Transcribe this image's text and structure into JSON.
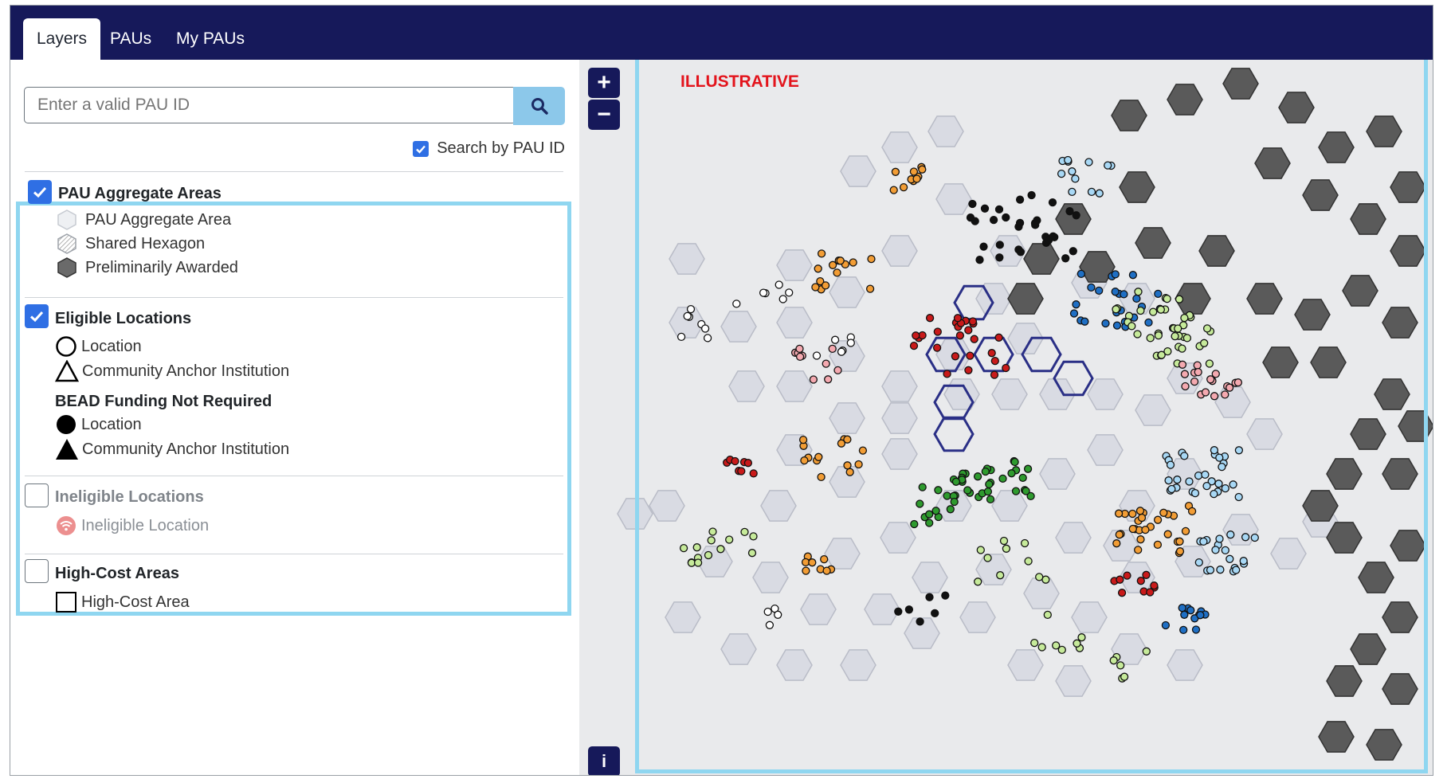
{
  "tabs": [
    {
      "label": "Layers",
      "active": true
    },
    {
      "label": "PAUs",
      "active": false
    },
    {
      "label": "My PAUs",
      "active": false
    }
  ],
  "search": {
    "placeholder": "Enter a valid PAU ID",
    "search_by_label": "Search by PAU ID",
    "search_by_checked": true
  },
  "legend": {
    "pau_aggregate_areas": {
      "title": "PAU Aggregate Areas",
      "checked": true,
      "items": [
        {
          "label": "PAU Aggregate Area",
          "icon": "hexagon-light-icon"
        },
        {
          "label": "Shared Hexagon",
          "icon": "hexagon-hatched-icon"
        },
        {
          "label": "Preliminarily Awarded",
          "icon": "hexagon-dark-icon"
        }
      ]
    },
    "eligible_locations": {
      "title": "Eligible Locations",
      "checked": true,
      "items": [
        {
          "label": "Location",
          "icon": "circle-outline-icon"
        },
        {
          "label": "Community Anchor Institution",
          "icon": "triangle-outline-icon"
        }
      ],
      "subgroup_title": "BEAD Funding Not Required",
      "subgroup_items": [
        {
          "label": "Location",
          "icon": "circle-filled-icon"
        },
        {
          "label": "Community Anchor Institution",
          "icon": "triangle-filled-icon"
        }
      ]
    },
    "ineligible_locations": {
      "title": "Ineligible Locations",
      "checked": false,
      "items": [
        {
          "label": "Ineligible Location",
          "icon": "wifi-ineligible-icon"
        }
      ]
    },
    "high_cost_areas": {
      "title": "High-Cost Areas",
      "checked": false,
      "items": [
        {
          "label": "High-Cost Area",
          "icon": "square-outline-icon"
        }
      ]
    }
  },
  "map": {
    "watermark": "ILLUSTRATIVE",
    "zoom_in": "+",
    "zoom_out": "−",
    "info": "i",
    "colors": {
      "hex_light": "#d9dbe3",
      "hex_dark": "#5a5a5a",
      "selected_outline": "#2a2f86",
      "highlight_border": "#8fd6f0",
      "dot_colors": [
        "#1f6fc4",
        "#2e9a2e",
        "#c91a1a",
        "#f29d35",
        "#a8d8f5",
        "#c6ea9a",
        "#f4a9b0",
        "#111111",
        "#ffffff"
      ]
    }
  },
  "colors": {
    "header": "#16195a",
    "accent": "#2f6fe4",
    "search_button": "#8cc8ea"
  }
}
